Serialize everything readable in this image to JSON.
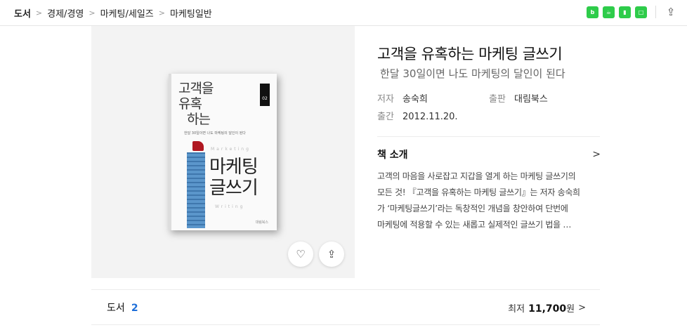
{
  "breadcrumb": {
    "items": [
      "도서",
      "경제/경영",
      "마케팅/세일즈",
      "마케팅일반"
    ]
  },
  "toolbar": {
    "icons": [
      "blog-icon",
      "cafe-icon",
      "bookmark-icon",
      "memo-icon",
      "share-icon"
    ]
  },
  "book": {
    "cover": {
      "title_top": "고객을 유혹하는",
      "line1": "고객을",
      "line2": "유혹",
      "line3": "하는",
      "sub": "한달 30일이면 나도 마케팅의 달인이 된다",
      "badge": "02",
      "main_l1": "마케팅",
      "main_l2": "글쓰기",
      "eng1": "Marketing",
      "eng2": "Writing",
      "publisher": "대림북스"
    },
    "title": "고객을 유혹하는 마케팅 글쓰기",
    "subtitle": "한달 30일이면 나도 마케팅의 달인이 된다",
    "author_label": "저자",
    "author": "송숙희",
    "publisher_label": "출판",
    "publisher": "대림북스",
    "date_label": "출간",
    "date": "2012.11.20."
  },
  "intro": {
    "title": "책 소개",
    "lines": [
      "고객의 마음을 사로잡고 지갑을 열게 하는 마케팅 글쓰기의",
      "모든 것! 『고객을 유혹하는 마케팅 글쓰기』는 저자 송숙희",
      "가 ‘마케팅글쓰기’라는 독창적인 개념을 창안하여 단번에",
      "마케팅에 적용할 수 있는 새롭고 실제적인 글쓰기 법을 …"
    ]
  },
  "bottom": {
    "label": "도서",
    "count": "2",
    "price_prefix": "최저",
    "price": "11,700",
    "price_suffix": "원"
  }
}
